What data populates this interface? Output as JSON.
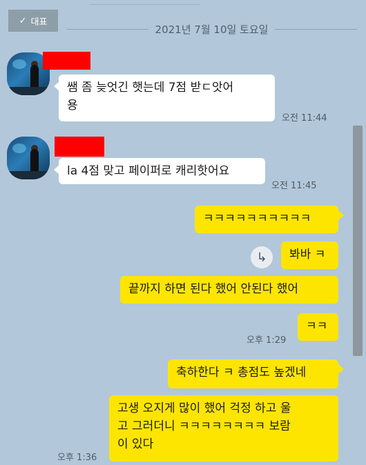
{
  "badge": {
    "label": "대표"
  },
  "date": "2021년 7월 10일 토요일",
  "messages": {
    "m1": {
      "line1": "쌤 좀 늦엇긴 햇는데 7점 받ㄷ앗어",
      "line2": "용",
      "time": "오전 11:44"
    },
    "m2": {
      "text": "la 4점 맞고 페이퍼로 캐리핫어요",
      "time": "오전 11:45"
    },
    "m3": {
      "text": "ㅋㅋㅋㅋㅋㅋㅋㅋㅋㅋ"
    },
    "m4": {
      "text": "봐바 ㅋ"
    },
    "m5": {
      "text": "끝까지 하면 된다 했어 안된다 했어"
    },
    "m6": {
      "text": "ㅋㅋ",
      "time": "오후 1:29"
    },
    "m7": {
      "text": "축하한다 ㅋ 총점도 높겠네"
    },
    "m8": {
      "line1": "고생 오지게 많이 했어 걱정 하고 울",
      "line2": "고 그러더니 ㅋㅋㅋㅋㅋㅋㅋㅋ 보람",
      "line3": "이 있다",
      "time": "오후 1:36"
    }
  },
  "icons": {
    "reply": "reply-arrow-icon",
    "check": "check-icon"
  },
  "colors": {
    "background": "#b2c7d9",
    "incoming": "#ffffff",
    "outgoing": "#fee500",
    "redacted": "#ff0000"
  }
}
